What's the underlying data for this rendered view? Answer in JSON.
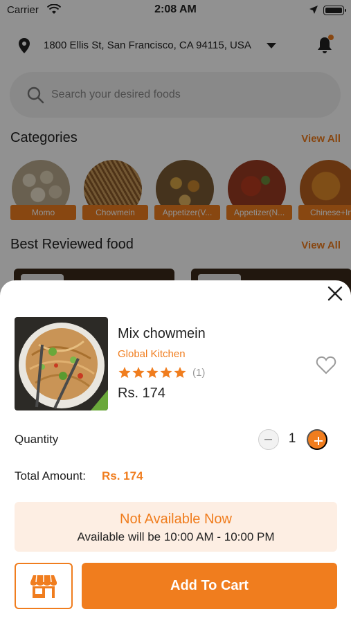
{
  "status_bar": {
    "carrier": "Carrier",
    "time": "2:08 AM"
  },
  "header": {
    "address": "1800 Ellis St, San Francisco, CA 94115, USA",
    "icons": [
      "location-pin-icon",
      "chevron-down-icon",
      "bell-icon"
    ]
  },
  "search": {
    "placeholder": "Search your desired foods"
  },
  "categories": {
    "title": "Categories",
    "view_all": "View All",
    "items": [
      {
        "label": "Momo"
      },
      {
        "label": "Chowmein"
      },
      {
        "label": "Appetizer(V..."
      },
      {
        "label": "Appetizer(N..."
      },
      {
        "label": "Chinese+In"
      }
    ]
  },
  "best_reviewed": {
    "title": "Best Reviewed food",
    "view_all": "View All"
  },
  "sheet": {
    "product_name": "Mix chowmein",
    "kitchen": "Global Kitchen",
    "rating_stars": 5,
    "rating_count": "(1)",
    "price": "Rs. 174",
    "quantity_label": "Quantity",
    "quantity": "1",
    "total_label": "Total Amount:",
    "total_value": "Rs. 174",
    "availability_title": "Not Available Now",
    "availability_time": "Available will be 10:00 AM - 10:00 PM",
    "add_to_cart": "Add To Cart"
  },
  "colors": {
    "accent": "#f07d1e",
    "availability_bg": "#fdeee3",
    "overlay": "rgba(0,0,0,0.43)"
  }
}
